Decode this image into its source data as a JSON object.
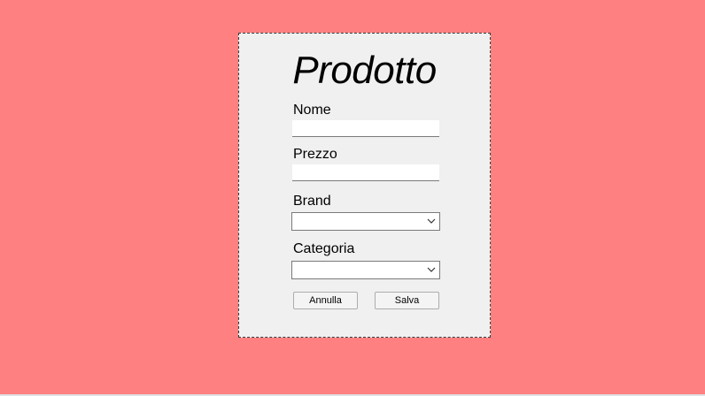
{
  "form": {
    "title": "Prodotto",
    "nome_label": "Nome",
    "nome_value": "",
    "prezzo_label": "Prezzo",
    "prezzo_value": "",
    "brand_label": "Brand",
    "brand_selected": "",
    "categoria_label": "Categoria",
    "categoria_selected": "",
    "cancel_label": "Annulla",
    "save_label": "Salva"
  },
  "colors": {
    "background": "#ff8080",
    "panel": "#f0f0f0"
  },
  "icons": {
    "dropdown": "chevron-down-icon"
  }
}
